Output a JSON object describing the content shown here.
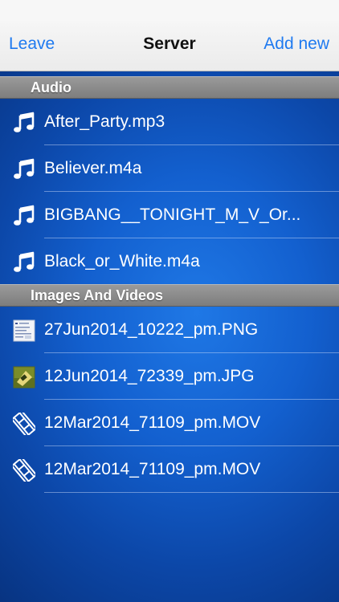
{
  "nav": {
    "leave_label": "Leave",
    "title": "Server",
    "add_label": "Add new",
    "accent_color": "#1f7af0"
  },
  "sections": [
    {
      "header": "Audio",
      "items": [
        {
          "name": "After_Party.mp3",
          "icon": "music-note-icon"
        },
        {
          "name": "Believer.m4a",
          "icon": "music-note-icon"
        },
        {
          "name": "BIGBANG__TONIGHT_M_V_Or...",
          "icon": "music-note-icon"
        },
        {
          "name": "Black_or_White.m4a",
          "icon": "music-note-icon"
        }
      ]
    },
    {
      "header": "Images And Videos",
      "items": [
        {
          "name": "27Jun2014_10222_pm.PNG",
          "icon": "image-thumbnail-icon"
        },
        {
          "name": "12Jun2014_72339_pm.JPG",
          "icon": "image-thumbnail-icon"
        },
        {
          "name": "12Mar2014_71109_pm.MOV",
          "icon": "film-strip-icon"
        },
        {
          "name": "12Mar2014_71109_pm.MOV",
          "icon": "film-strip-icon"
        }
      ]
    }
  ]
}
